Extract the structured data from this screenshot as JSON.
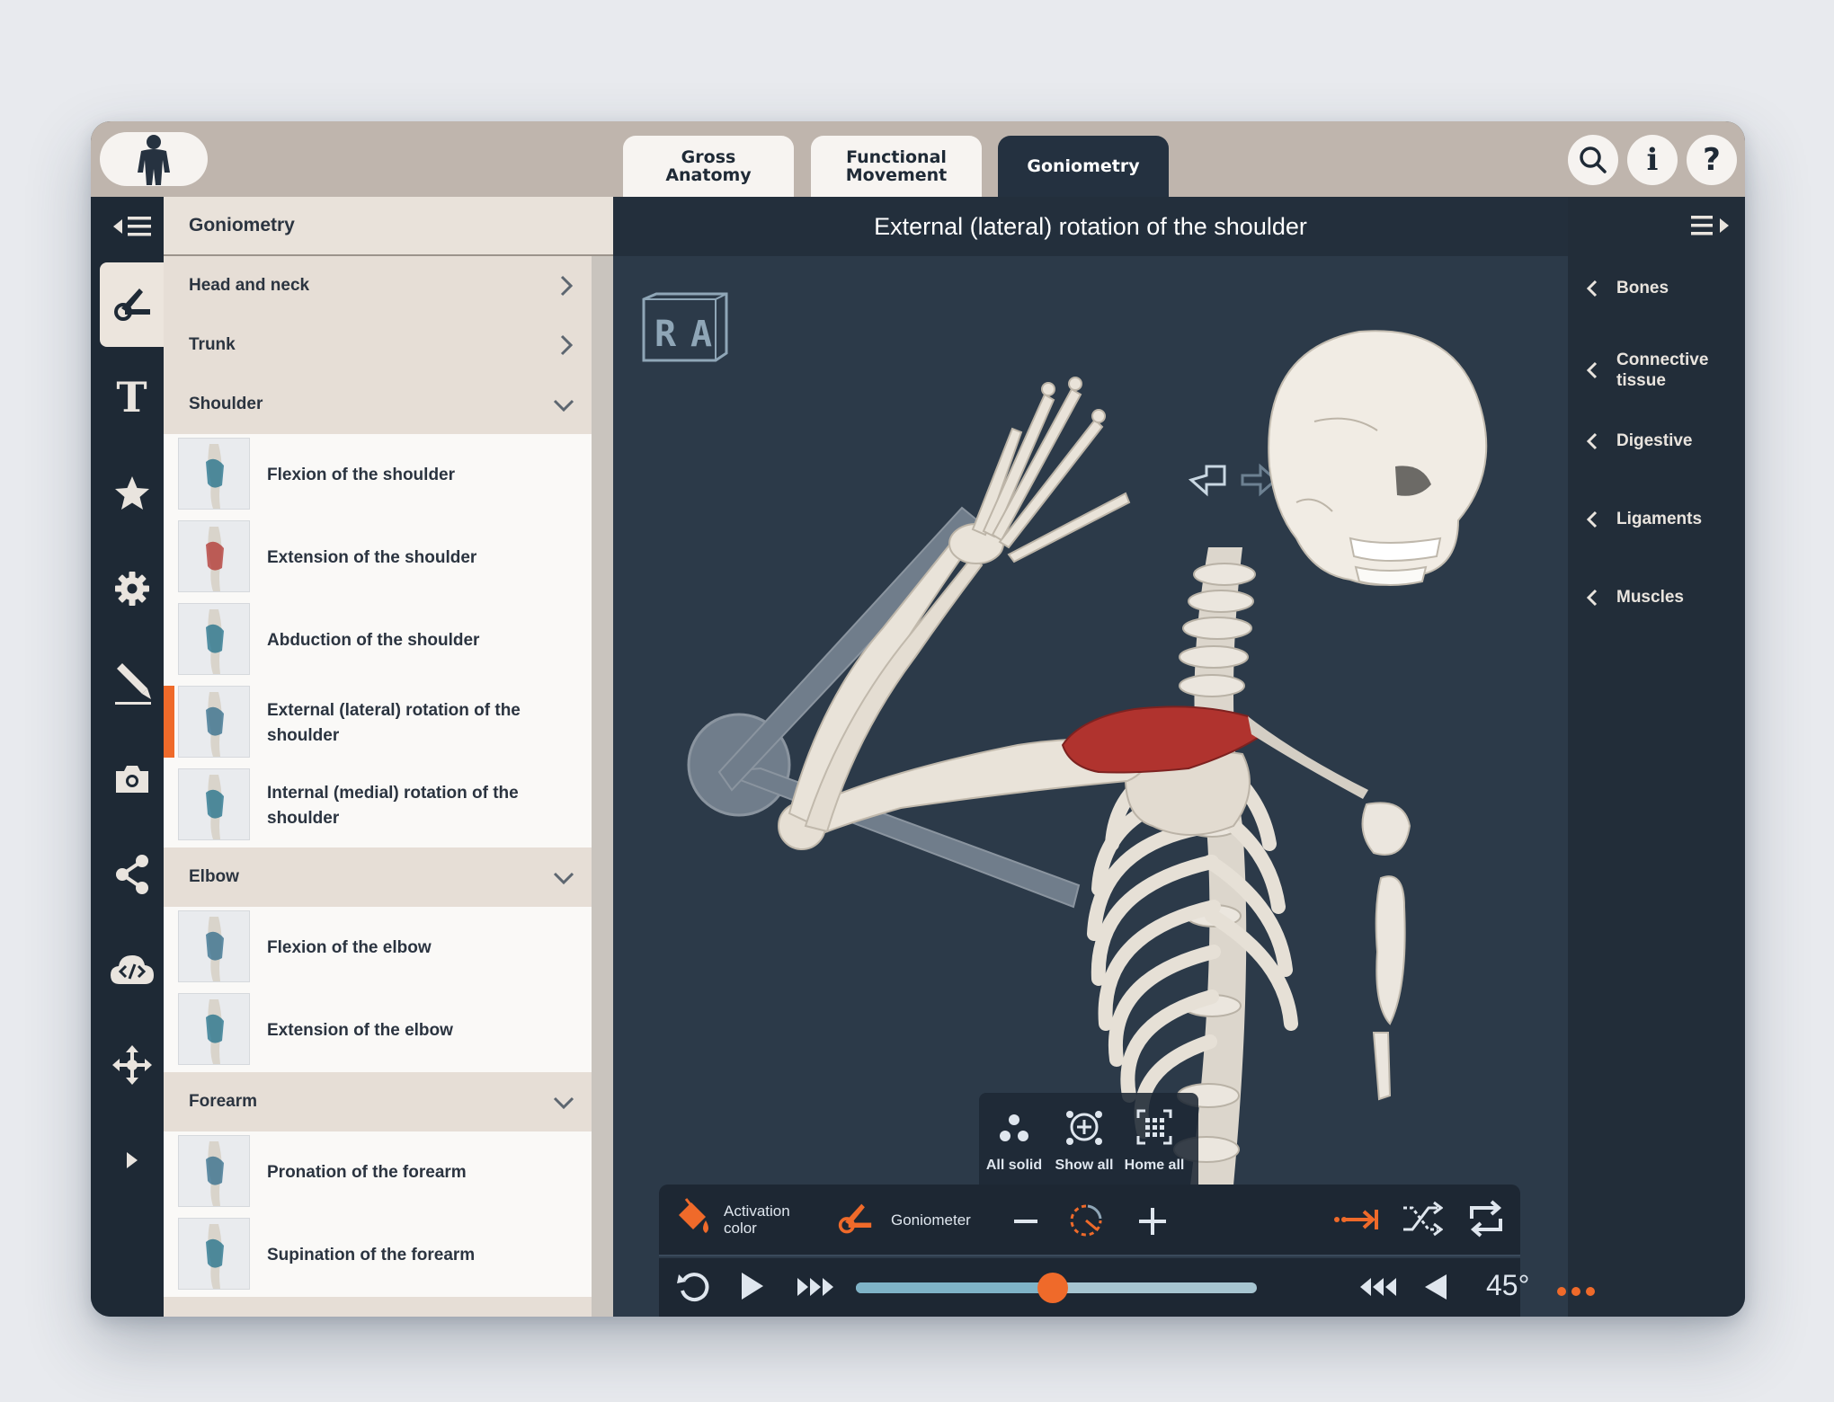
{
  "tabs": [
    {
      "label": "Gross\nAnatomy",
      "active": false
    },
    {
      "label": "Functional\nMovement",
      "active": false
    },
    {
      "label": "Goniometry",
      "active": true
    }
  ],
  "topbar": {
    "logo_icon": "human-figure-icon",
    "search_icon": "search-icon",
    "info_label": "i",
    "help_label": "?"
  },
  "rail": {
    "icons": [
      "collapse-menu-icon",
      "goniometer-icon",
      "text-icon",
      "star-icon",
      "gear-icon",
      "pencil-icon",
      "camera-icon",
      "share-icon",
      "cloud-code-icon",
      "move-icon",
      "expand-icon"
    ]
  },
  "list": {
    "header": "Goniometry",
    "sections": [
      {
        "label": "Head and neck",
        "expanded": false,
        "items": []
      },
      {
        "label": "Trunk",
        "expanded": false,
        "items": []
      },
      {
        "label": "Shoulder",
        "expanded": true,
        "items": [
          {
            "label": "Flexion of the shoulder",
            "selected": false
          },
          {
            "label": "Extension of the shoulder",
            "selected": false
          },
          {
            "label": "Abduction of the shoulder",
            "selected": false
          },
          {
            "label": "External (lateral) rotation of the shoulder",
            "selected": true
          },
          {
            "label": "Internal (medial) rotation of the shoulder",
            "selected": false
          }
        ]
      },
      {
        "label": "Elbow",
        "expanded": true,
        "items": [
          {
            "label": "Flexion of the elbow",
            "selected": false
          },
          {
            "label": "Extension of the elbow",
            "selected": false
          }
        ]
      },
      {
        "label": "Forearm",
        "expanded": true,
        "items": [
          {
            "label": "Pronation of the forearm",
            "selected": false
          },
          {
            "label": "Supination of the forearm",
            "selected": false
          }
        ]
      }
    ]
  },
  "viewer": {
    "title": "External (lateral) rotation of the shoulder",
    "orientation_cube": "R A",
    "accent": "#ef6a2a"
  },
  "right_panel": {
    "items": [
      "Bones",
      "Connective\ntissue",
      "Digestive",
      "Ligaments",
      "Muscles"
    ]
  },
  "mini_toolbar": {
    "all_solid": "All solid",
    "show_all": "Show all",
    "home_all": "Home all"
  },
  "controls": {
    "activation_color": "Activation\ncolor",
    "goniometer": "Goniometer",
    "angle": "45°",
    "progress_fraction": 0.49
  }
}
